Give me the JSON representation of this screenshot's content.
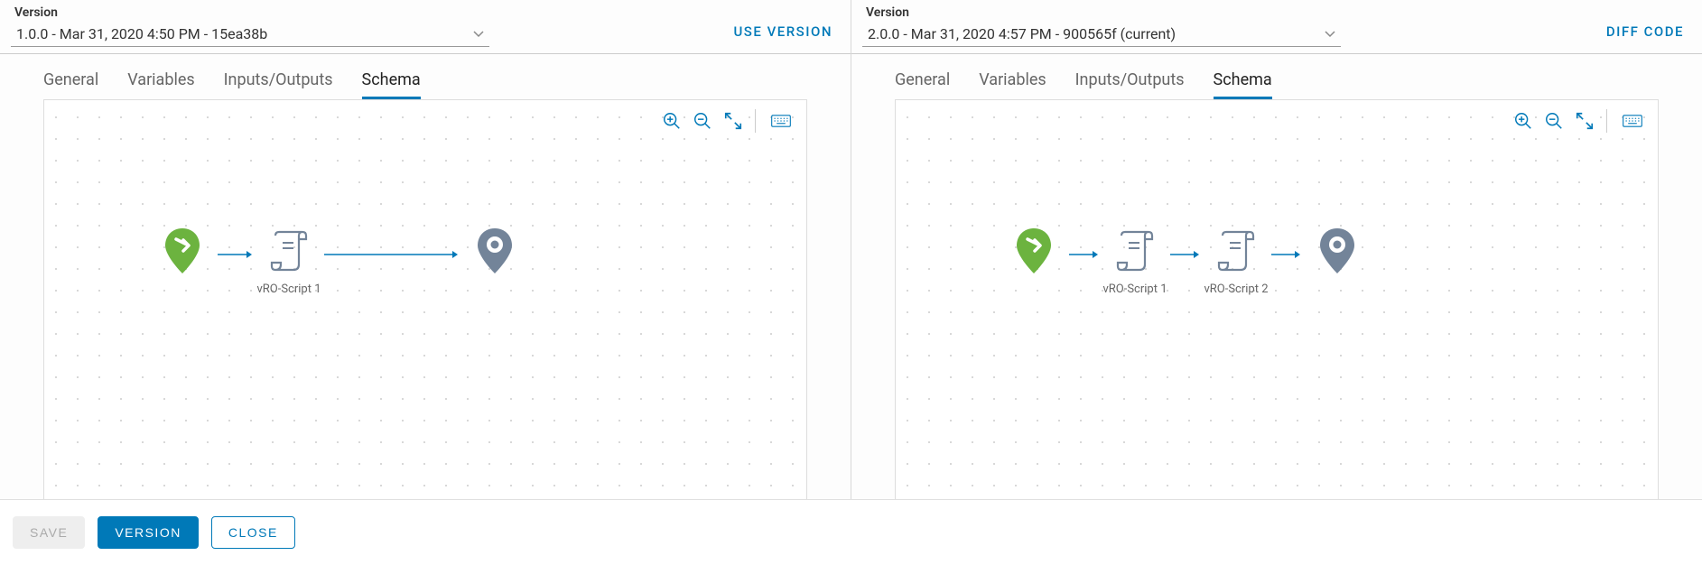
{
  "left": {
    "version_label": "Version",
    "version_value": "1.0.0 - Mar 31, 2020 4:50 PM - 15ea38b",
    "action": "USE VERSION",
    "tabs": {
      "general": "General",
      "variables": "Variables",
      "io": "Inputs/Outputs",
      "schema": "Schema"
    },
    "nodes": {
      "script1": "vRO-Script 1"
    }
  },
  "right": {
    "version_label": "Version",
    "version_value": "2.0.0 - Mar 31, 2020 4:57 PM - 900565f (current)",
    "action": "DIFF CODE",
    "tabs": {
      "general": "General",
      "variables": "Variables",
      "io": "Inputs/Outputs",
      "schema": "Schema"
    },
    "nodes": {
      "script1": "vRO-Script 1",
      "script2": "vRO-Script 2"
    }
  },
  "footer": {
    "save": "SAVE",
    "version": "VERSION",
    "close": "CLOSE"
  },
  "colors": {
    "accent": "#0079b8",
    "start": "#6cb33f",
    "node": "#738499"
  }
}
